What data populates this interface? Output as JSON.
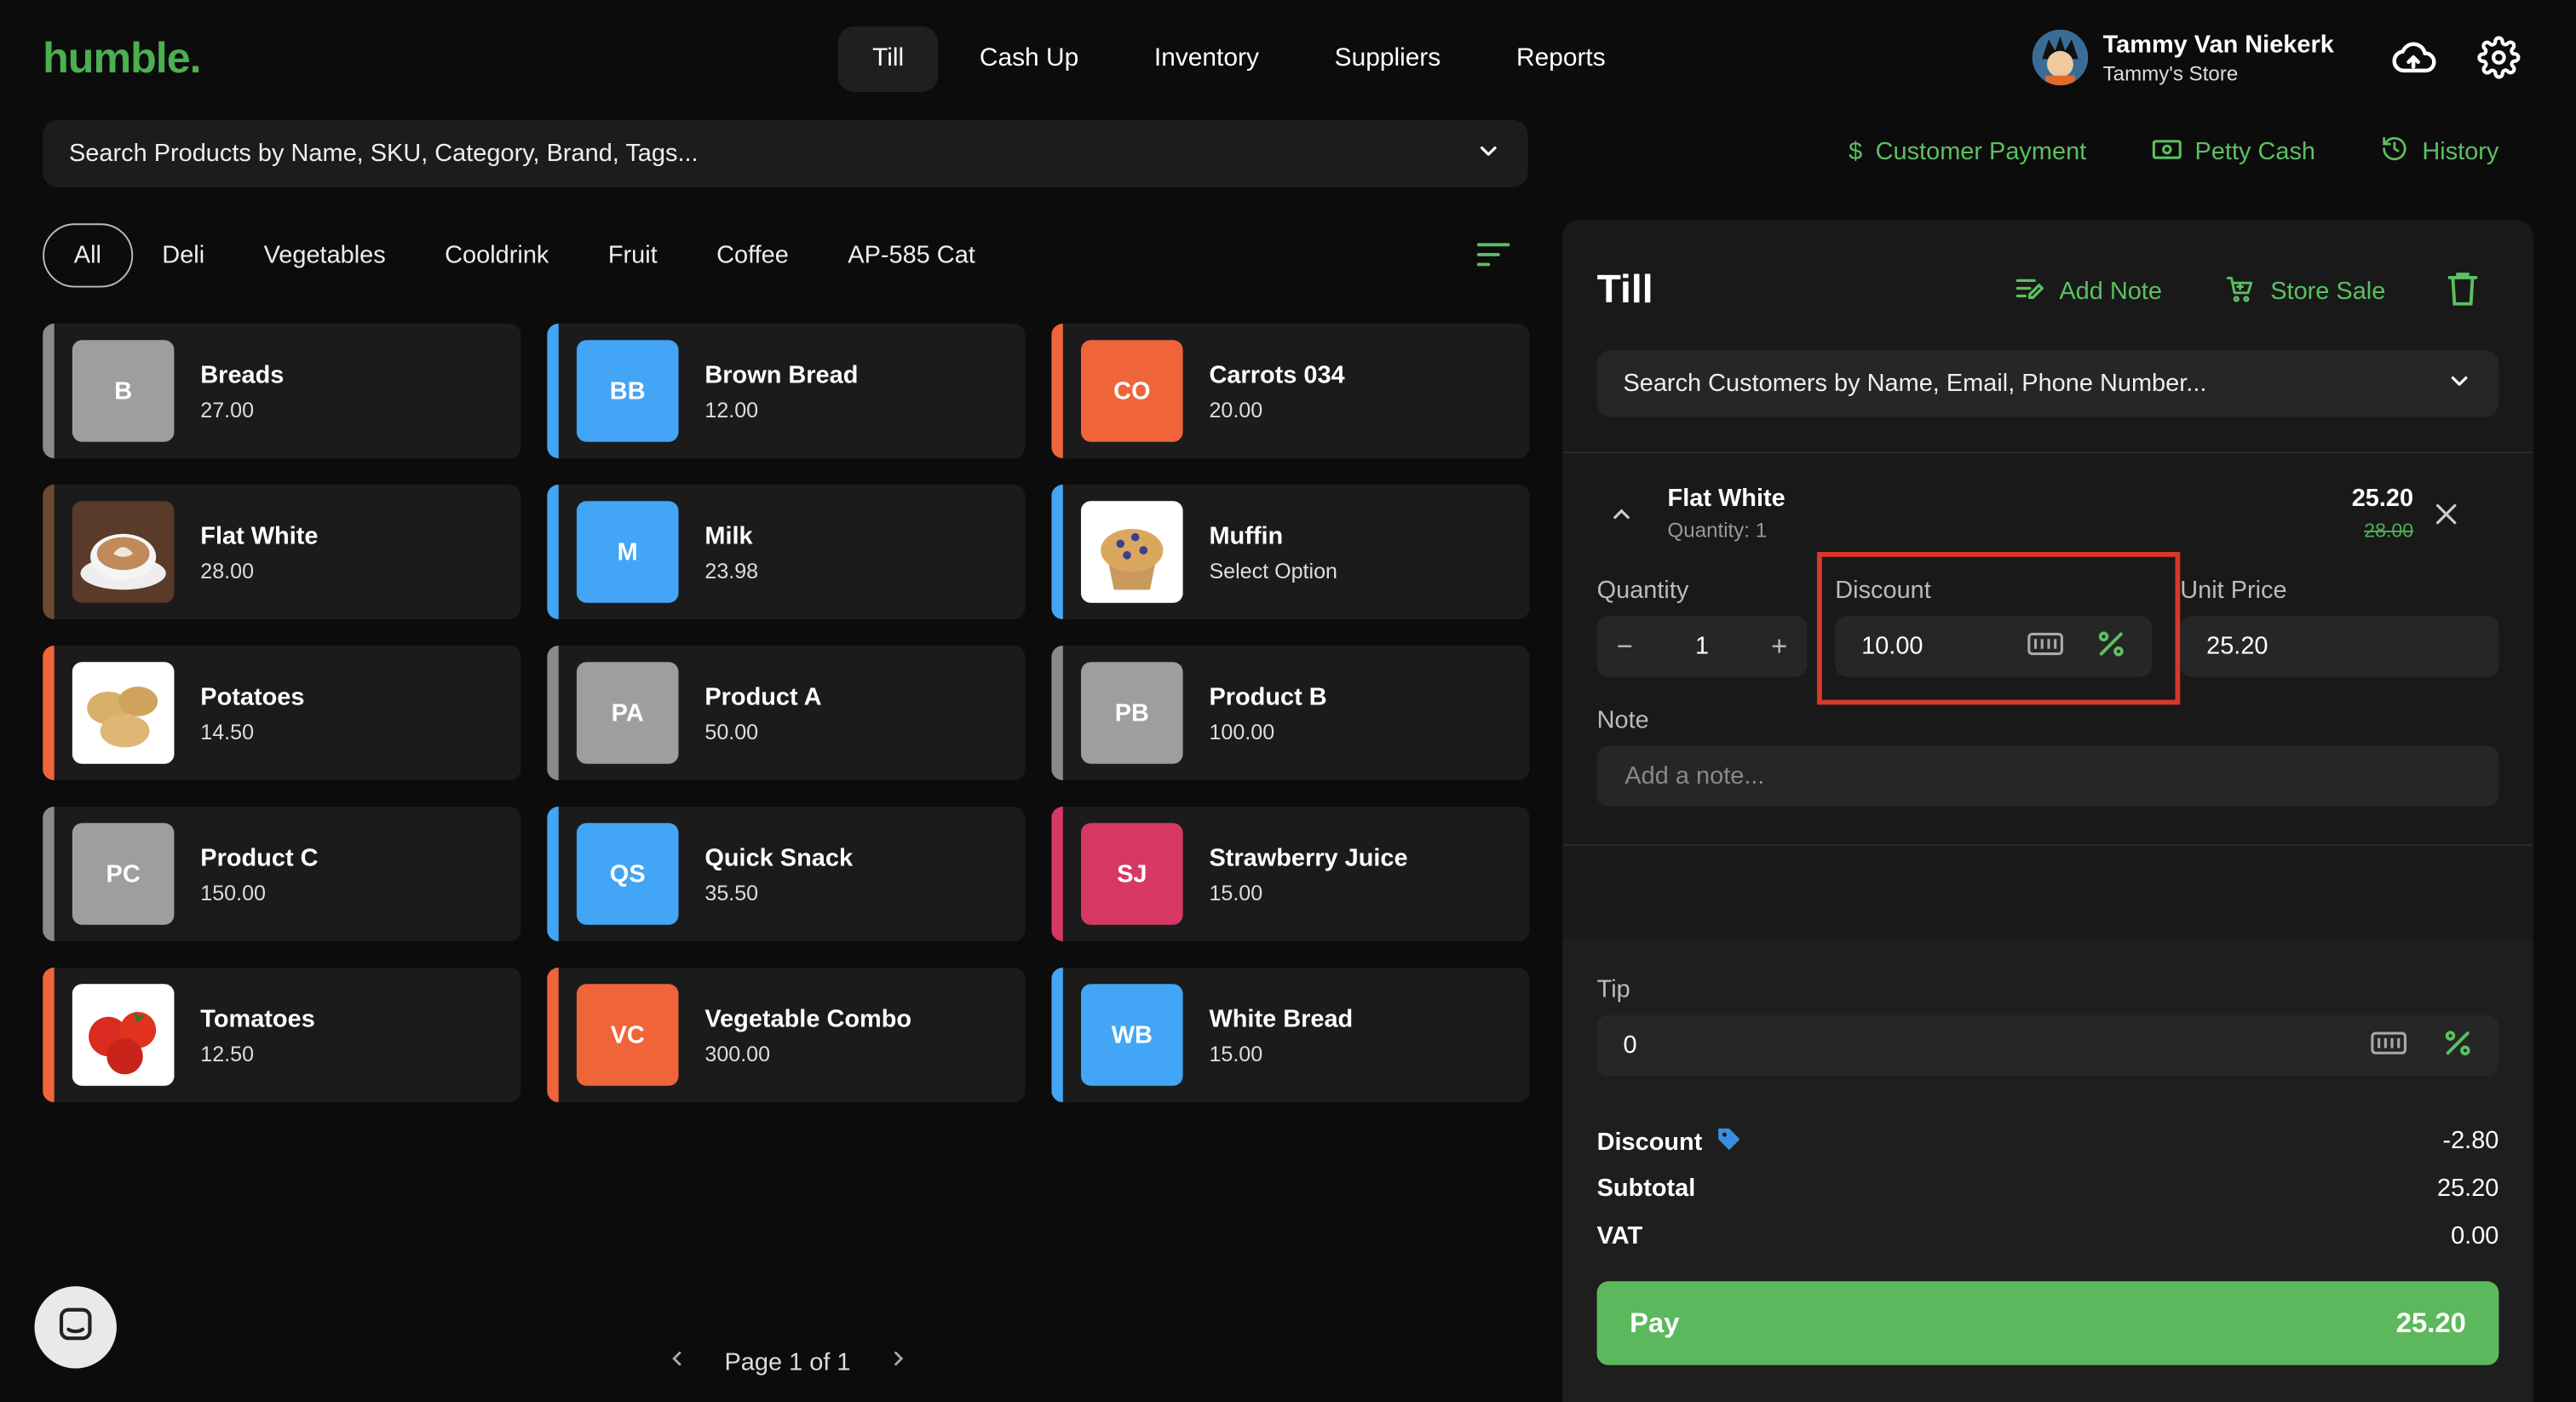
{
  "brand": "humble.",
  "nav": [
    "Till",
    "Cash Up",
    "Inventory",
    "Suppliers",
    "Reports"
  ],
  "user": {
    "name": "Tammy Van Niekerk",
    "store": "Tammy's Store"
  },
  "search": {
    "placeholder": "Search Products by Name, SKU, Category, Brand, Tags..."
  },
  "actions": {
    "customer_payment": "Customer Payment",
    "petty_cash": "Petty Cash",
    "history": "History"
  },
  "categories": [
    "All",
    "Deli",
    "Vegetables",
    "Cooldrink",
    "Fruit",
    "Coffee",
    "AP-585 Cat"
  ],
  "products": [
    {
      "name": "Breads",
      "price": "27.00",
      "initials": "B",
      "color": "#9e9e9e",
      "stripe": "#8a8a8a",
      "image": ""
    },
    {
      "name": "Brown Bread",
      "price": "12.00",
      "initials": "BB",
      "color": "#42a5f5",
      "stripe": "#42a5f5",
      "image": ""
    },
    {
      "name": "Carrots 034",
      "price": "20.00",
      "initials": "CO",
      "color": "#f0643a",
      "stripe": "#f0643a",
      "image": ""
    },
    {
      "name": "Flat White",
      "price": "28.00",
      "initials": "",
      "color": "#5a3a28",
      "stripe": "#6b4a35",
      "image": "coffee"
    },
    {
      "name": "Milk",
      "price": "23.98",
      "initials": "M",
      "color": "#42a5f5",
      "stripe": "#42a5f5",
      "image": ""
    },
    {
      "name": "Muffin",
      "price": "Select Option",
      "initials": "",
      "color": "#ffffff",
      "stripe": "#42a5f5",
      "image": "muffin"
    },
    {
      "name": "Potatoes",
      "price": "14.50",
      "initials": "",
      "color": "#ffffff",
      "stripe": "#f0643a",
      "image": "potato"
    },
    {
      "name": "Product A",
      "price": "50.00",
      "initials": "PA",
      "color": "#9e9e9e",
      "stripe": "#8a8a8a",
      "image": ""
    },
    {
      "name": "Product B",
      "price": "100.00",
      "initials": "PB",
      "color": "#9e9e9e",
      "stripe": "#8a8a8a",
      "image": ""
    },
    {
      "name": "Product C",
      "price": "150.00",
      "initials": "PC",
      "color": "#9e9e9e",
      "stripe": "#8a8a8a",
      "image": ""
    },
    {
      "name": "Quick Snack",
      "price": "35.50",
      "initials": "QS",
      "color": "#42a5f5",
      "stripe": "#42a5f5",
      "image": ""
    },
    {
      "name": "Strawberry Juice",
      "price": "15.00",
      "initials": "SJ",
      "color": "#d63864",
      "stripe": "#d63864",
      "image": ""
    },
    {
      "name": "Tomatoes",
      "price": "12.50",
      "initials": "",
      "color": "#ffffff",
      "stripe": "#f0643a",
      "image": "tomato"
    },
    {
      "name": "Vegetable Combo",
      "price": "300.00",
      "initials": "VC",
      "color": "#f0643a",
      "stripe": "#f0643a",
      "image": ""
    },
    {
      "name": "White Bread",
      "price": "15.00",
      "initials": "WB",
      "color": "#42a5f5",
      "stripe": "#42a5f5",
      "image": ""
    }
  ],
  "pager": {
    "label": "Page 1 of 1"
  },
  "till": {
    "title": "Till",
    "add_note": "Add Note",
    "store_sale": "Store Sale",
    "customer_search_placeholder": "Search Customers by Name, Email, Phone Number...",
    "item": {
      "name": "Flat White",
      "quantity_text": "Quantity: 1",
      "price": "25.20",
      "original_price": "28.00"
    },
    "labels": {
      "quantity": "Quantity",
      "discount": "Discount",
      "unit_price": "Unit Price",
      "note": "Note",
      "tip": "Tip"
    },
    "quantity_value": "1",
    "discount_value": "10.00",
    "unit_price_value": "25.20",
    "note_placeholder": "Add a note...",
    "tip_value": "0",
    "summary": {
      "discount_label": "Discount",
      "discount_value": "-2.80",
      "subtotal_label": "Subtotal",
      "subtotal_value": "25.20",
      "vat_label": "VAT",
      "vat_value": "0.00"
    },
    "pay_label": "Pay",
    "pay_amount": "25.20"
  },
  "colors": {
    "accent": "#5cc061",
    "pay": "#5cb85c",
    "highlight": "#d9372a"
  }
}
